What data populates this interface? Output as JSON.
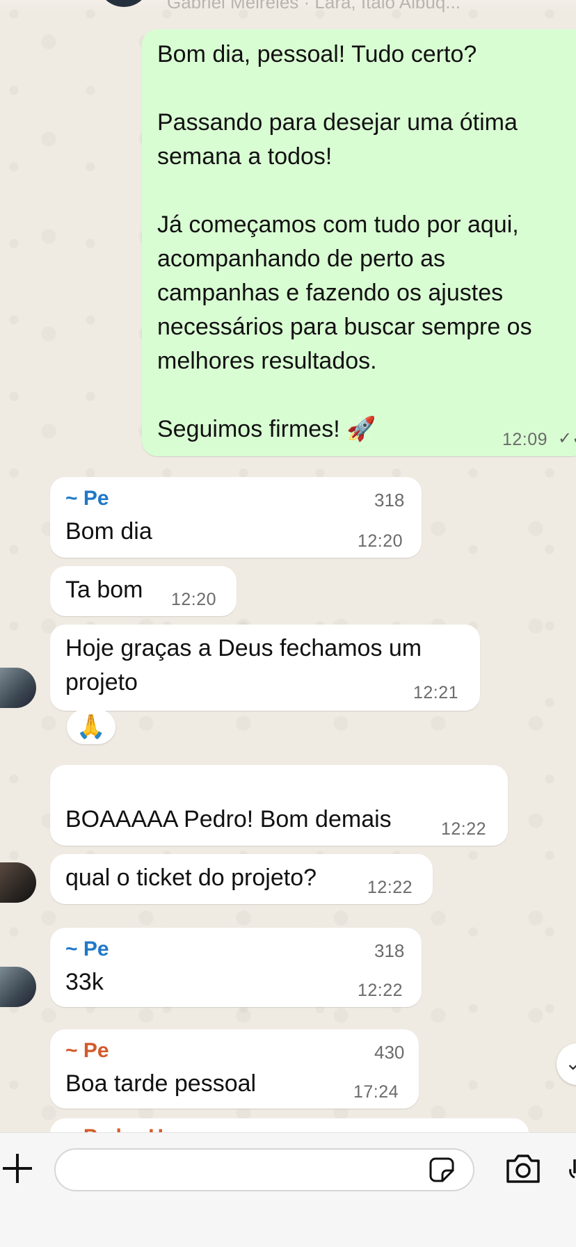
{
  "header": {
    "partial_text": "Gabriel Meireles · Lara, Italo Albuq..."
  },
  "messages": [
    {
      "id": "m1",
      "direction": "outgoing",
      "text": "Bom dia, pessoal! Tudo certo?\n\nPassando para desejar uma ótima\nsemana a todos!\n\nJá começamos com tudo por aqui,\nacompanhando de perto as\ncampanhas e fazendo os ajustes\nnecessários para buscar sempre os\nmelhores resultados.\n\nSeguimos firmes! 🚀",
      "time": "12:09",
      "ticks": "✓✓"
    },
    {
      "id": "m2",
      "direction": "incoming",
      "sender": "~ Pe",
      "sender_tail": "318",
      "text": "Bom dia",
      "time": "12:20"
    },
    {
      "id": "m3",
      "direction": "incoming",
      "text": "Ta bom",
      "time": "12:20"
    },
    {
      "id": "m4",
      "direction": "incoming",
      "text": "Hoje graças a Deus fechamos um\nprojeto",
      "time": "12:21",
      "reaction": "🙏"
    },
    {
      "id": "m5",
      "direction": "incoming",
      "text": "BOAAAAA Pedro! Bom demais",
      "time": "12:22"
    },
    {
      "id": "m6",
      "direction": "incoming",
      "text": "qual o ticket do projeto?",
      "time": "12:22"
    },
    {
      "id": "m7",
      "direction": "incoming",
      "sender": "~ Pe",
      "sender_tail": "318",
      "text": "33k",
      "time": "12:22"
    },
    {
      "id": "m8",
      "direction": "incoming",
      "sender": "~ Pe",
      "sender_tail": "430",
      "text": "Boa tarde pessoal",
      "time": "17:24"
    }
  ],
  "partial_message": {
    "sender": "~ Pedro H..."
  },
  "composer": {
    "placeholder": ""
  },
  "icons": {
    "attach": "plus-icon",
    "sticker": "sticker-icon",
    "camera": "camera-icon",
    "mic": "mic-icon",
    "scroll_down": "chevron-down-icon"
  },
  "colors": {
    "outgoing_bubble": "#d9fdd3",
    "incoming_bubble": "#ffffff",
    "sender_blue": "#1f78c8",
    "sender_orange": "#d35a2a",
    "wallpaper": "#efeae2"
  }
}
